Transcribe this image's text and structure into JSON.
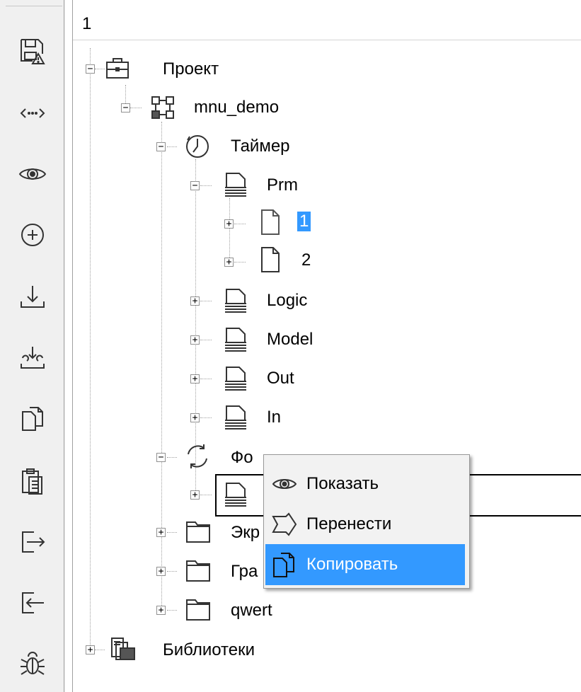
{
  "toolbar": {
    "buttons": [
      {
        "icon": "save-warning-icon"
      },
      {
        "icon": "code-arrows-icon"
      },
      {
        "icon": "eye-icon"
      },
      {
        "icon": "add-circle-icon"
      },
      {
        "icon": "download-icon"
      },
      {
        "icon": "import-icon"
      },
      {
        "icon": "copy-icon"
      },
      {
        "icon": "clipboard-icon"
      },
      {
        "icon": "export-icon"
      },
      {
        "icon": "login-icon"
      },
      {
        "icon": "bug-icon"
      }
    ]
  },
  "tree": {
    "header": "1",
    "root": {
      "label": "Проект",
      "icon": "briefcase-icon"
    },
    "mnu_demo": {
      "label": "mnu_demo",
      "icon": "network-icon"
    },
    "timer": {
      "label": "Таймер",
      "icon": "clock-icon"
    },
    "prm": {
      "label": "Prm",
      "icon": "stack-icon"
    },
    "item1": {
      "label": "1",
      "icon": "page-icon",
      "selected": true
    },
    "item2": {
      "label": "2",
      "icon": "page-icon"
    },
    "logic": {
      "label": "Logic",
      "icon": "stack-icon"
    },
    "model": {
      "label": "Model",
      "icon": "stack-icon"
    },
    "out": {
      "label": "Out",
      "icon": "stack-icon"
    },
    "in": {
      "label": "In",
      "icon": "stack-icon"
    },
    "phone": {
      "label": "Фо",
      "icon": "refresh-icon"
    },
    "screens": {
      "label": "Экр",
      "icon": "folder-icon"
    },
    "graphs": {
      "label": "Гра",
      "icon": "folder-icon"
    },
    "qwert": {
      "label": "qwert",
      "icon": "folder-icon"
    },
    "libraries": {
      "label": "Библиотеки",
      "icon": "library-icon"
    }
  },
  "context_menu": {
    "items": [
      {
        "label": "Показать",
        "icon": "eye-icon"
      },
      {
        "label": "Перенести",
        "icon": "move-arrow-icon"
      },
      {
        "label": "Копировать",
        "icon": "copy-icon",
        "highlighted": true
      }
    ]
  },
  "colors": {
    "selection": "#3399ff",
    "toolbar_bg": "#f0f0f0",
    "menu_bg": "#f2f2f2"
  }
}
